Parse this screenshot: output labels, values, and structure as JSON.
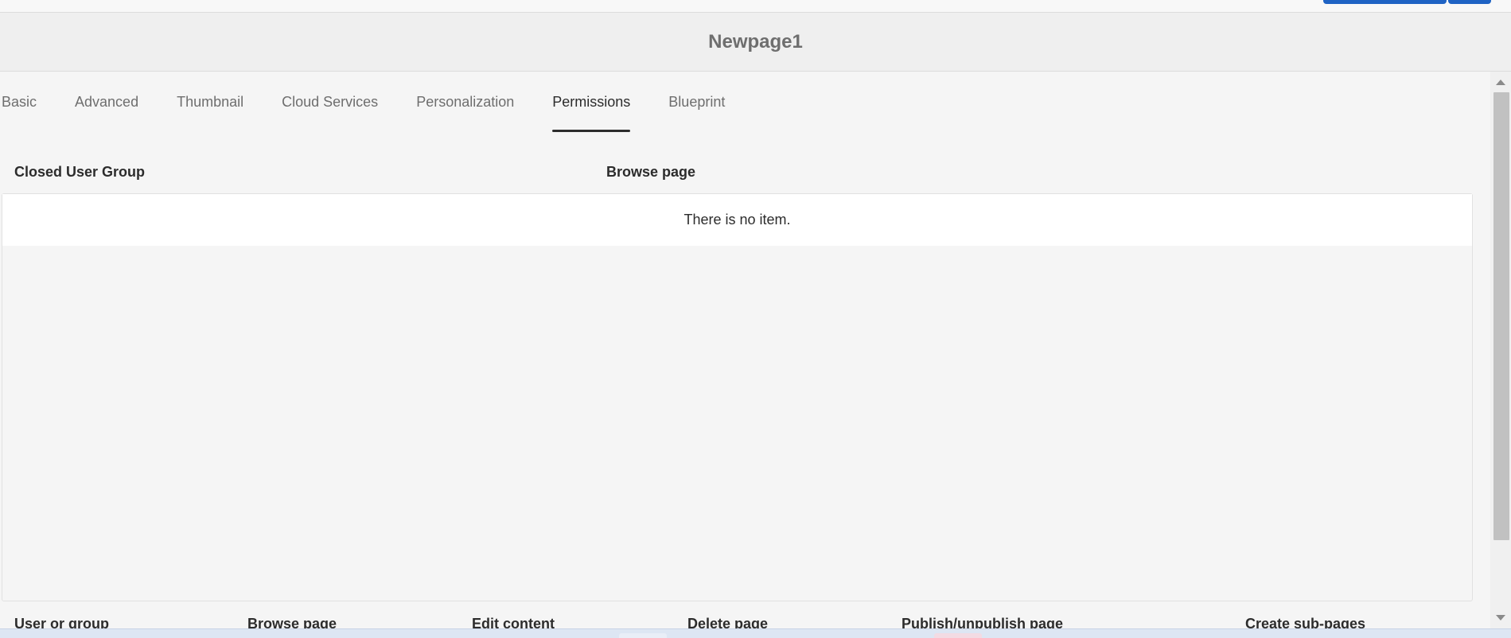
{
  "page": {
    "title": "Newpage1"
  },
  "tabs": [
    {
      "label": "Basic",
      "active": false
    },
    {
      "label": "Advanced",
      "active": false
    },
    {
      "label": "Thumbnail",
      "active": false
    },
    {
      "label": "Cloud Services",
      "active": false
    },
    {
      "label": "Personalization",
      "active": false
    },
    {
      "label": "Permissions",
      "active": true
    },
    {
      "label": "Blueprint",
      "active": false
    }
  ],
  "closed_user_group": {
    "label": "Closed User Group",
    "column_browse": "Browse page",
    "empty_message": "There is no item."
  },
  "permissions_table": {
    "columns": [
      "User or group",
      "Browse page",
      "Edit content",
      "Delete page",
      "Publish/unpublish page",
      "Create sub-pages"
    ]
  },
  "colors": {
    "accent": "#1f63c4",
    "background": "#f5f5f5",
    "title_text": "#6e6e6e"
  }
}
